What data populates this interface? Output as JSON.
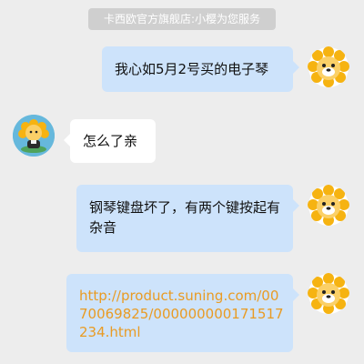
{
  "header": {
    "notice": "卡西欧官方旗舰店:小樱为您服务"
  },
  "messages": [
    {
      "side": "right",
      "text": "我心如5月2号买的电子琴",
      "avatar": "lion-mascot-icon"
    },
    {
      "side": "left",
      "text": "怎么了亲",
      "avatar": "agent-mascot-icon"
    },
    {
      "side": "right",
      "text": "钢琴键盘坏了，有两个键按起有杂音",
      "avatar": "lion-mascot-icon"
    },
    {
      "side": "right",
      "text": "http://product.suning.com/0070069825/000000000171517234.html",
      "is_link": true,
      "avatar": "lion-mascot-icon"
    }
  ],
  "colors": {
    "background": "#ededed",
    "user_bubble": "#cde3fb",
    "agent_bubble": "#ffffff",
    "link": "#e99b23",
    "notice_bg": "#cfcfcf",
    "lion_mane": "#f6b311",
    "agent_avatar_bg": "#66b8dc"
  }
}
